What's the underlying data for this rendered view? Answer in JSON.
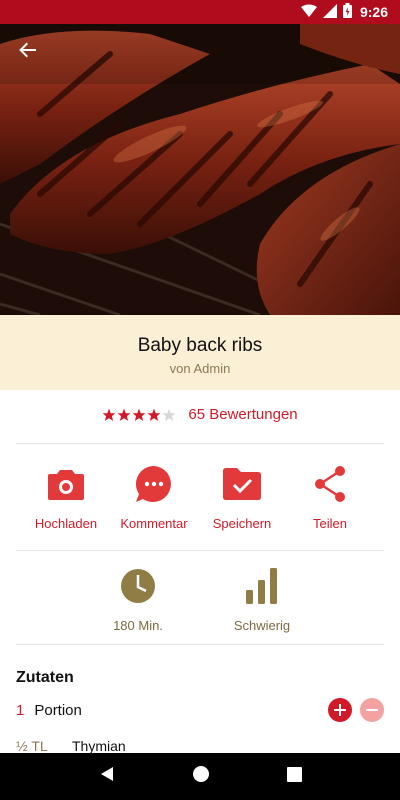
{
  "status_bar": {
    "time": "9:26"
  },
  "recipe": {
    "title": "Baby back ribs",
    "author": "von Admin",
    "rating_stars": 4,
    "rating_max": 5,
    "rating_text": "65 Bewertungen"
  },
  "actions": [
    {
      "label": "Hochladen",
      "icon": "camera-icon"
    },
    {
      "label": "Kommentar",
      "icon": "comment-icon"
    },
    {
      "label": "Speichern",
      "icon": "folder-check-icon"
    },
    {
      "label": "Teilen",
      "icon": "share-icon"
    }
  ],
  "meta": {
    "time_label": "180 Min.",
    "difficulty_label": "Schwierig"
  },
  "ingredients": {
    "title": "Zutaten",
    "portion_count": "1",
    "portion_label": "Portion",
    "items": [
      {
        "amount": "½ TL",
        "name": "Thymian"
      }
    ]
  },
  "colors": {
    "accent": "#d01a2a",
    "status_bar": "#b00c1e",
    "title_band": "#fbefd6",
    "meta_gold": "#8a7a55"
  }
}
